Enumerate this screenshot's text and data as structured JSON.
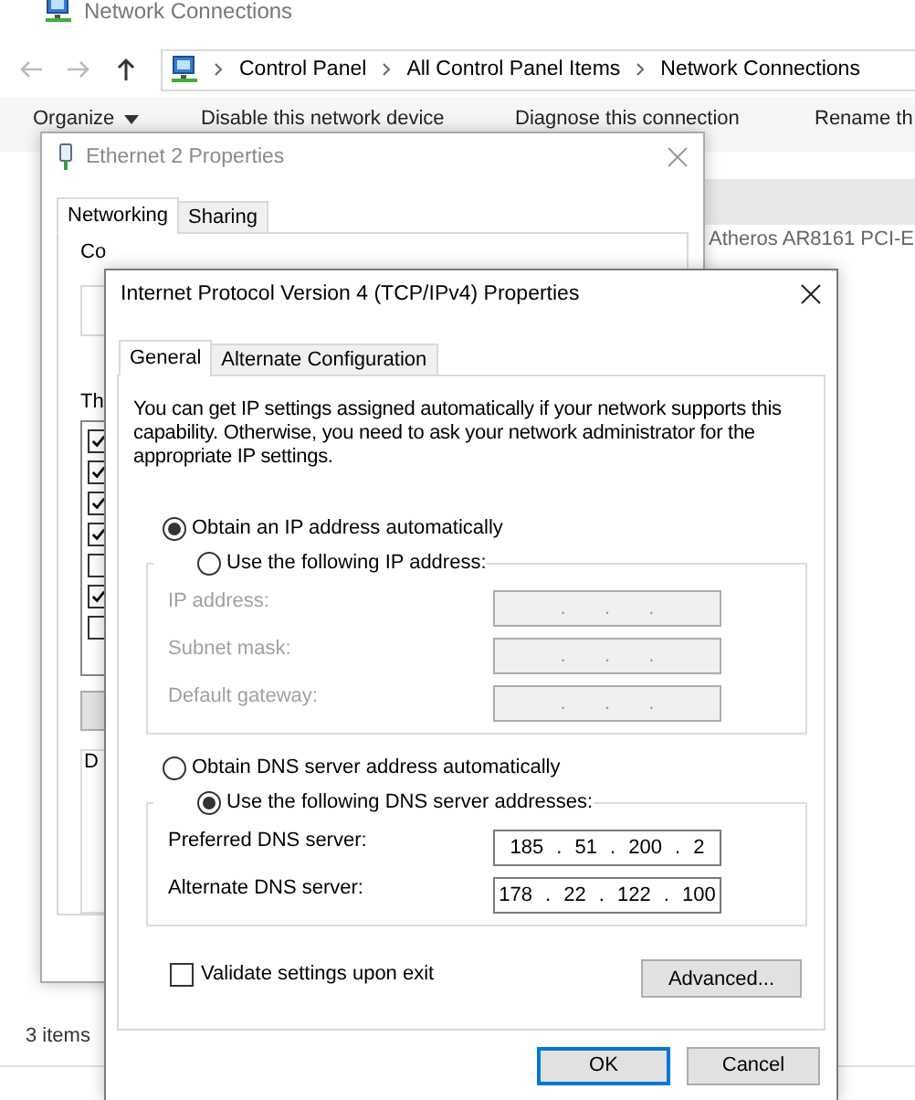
{
  "explorer": {
    "title": "Network Connections",
    "breadcrumbs": [
      "Control Panel",
      "All Control Panel Items",
      "Network Connections"
    ],
    "toolbar": [
      {
        "label": "Organize",
        "kind": "menu"
      },
      {
        "label": "Disable this network device",
        "kind": "plain"
      },
      {
        "label": "Diagnose this connection",
        "kind": "plain"
      },
      {
        "label": "Rename th",
        "kind": "plain"
      }
    ],
    "connection_item": "Atheros AR8161 PCI-E",
    "status_bar": "3 items"
  },
  "ethernet_dialog": {
    "title": "Ethernet 2 Properties",
    "tabs": [
      {
        "label": "Networking",
        "selected": true
      },
      {
        "label": "Sharing",
        "selected": false
      }
    ],
    "connect_label": "Co",
    "list_label": "Th",
    "group_label": "D",
    "components": [
      {
        "checked": true
      },
      {
        "checked": true
      },
      {
        "checked": true
      },
      {
        "checked": true
      },
      {
        "checked": false
      },
      {
        "checked": true
      },
      {
        "checked": false
      }
    ]
  },
  "ipv4_dialog": {
    "title": "Internet Protocol Version 4 (TCP/IPv4) Properties",
    "tabs": [
      {
        "label": "General",
        "selected": true
      },
      {
        "label": "Alternate Configuration",
        "selected": false
      }
    ],
    "intro": "You can get IP settings assigned automatically if your network supports this capability. Otherwise, you need to ask your network administrator for the appropriate IP settings.",
    "ip_auto": {
      "label": "Obtain an IP address automatically",
      "selected": true
    },
    "ip_manual": {
      "label": "Use the following IP address:",
      "selected": false,
      "disabled": true,
      "fields": [
        {
          "label": "IP address:",
          "value": ".   .   ."
        },
        {
          "label": "Subnet mask:",
          "value": ".   .   ."
        },
        {
          "label": "Default gateway:",
          "value": ".   .   ."
        }
      ]
    },
    "dns_auto": {
      "label": "Obtain DNS server address automatically",
      "selected": false
    },
    "dns_manual": {
      "label": "Use the following DNS server addresses:",
      "selected": true,
      "disabled": false,
      "fields": [
        {
          "label": "Preferred DNS server:",
          "value": "185 . 51 . 200 . 2"
        },
        {
          "label": "Alternate DNS server:",
          "value": "178 . 22 . 122 . 100"
        }
      ]
    },
    "validate": {
      "label": "Validate settings upon exit",
      "checked": false
    },
    "advanced_button": "Advanced...",
    "buttons": [
      {
        "label": "OK",
        "default": true
      },
      {
        "label": "Cancel",
        "default": false
      }
    ]
  }
}
